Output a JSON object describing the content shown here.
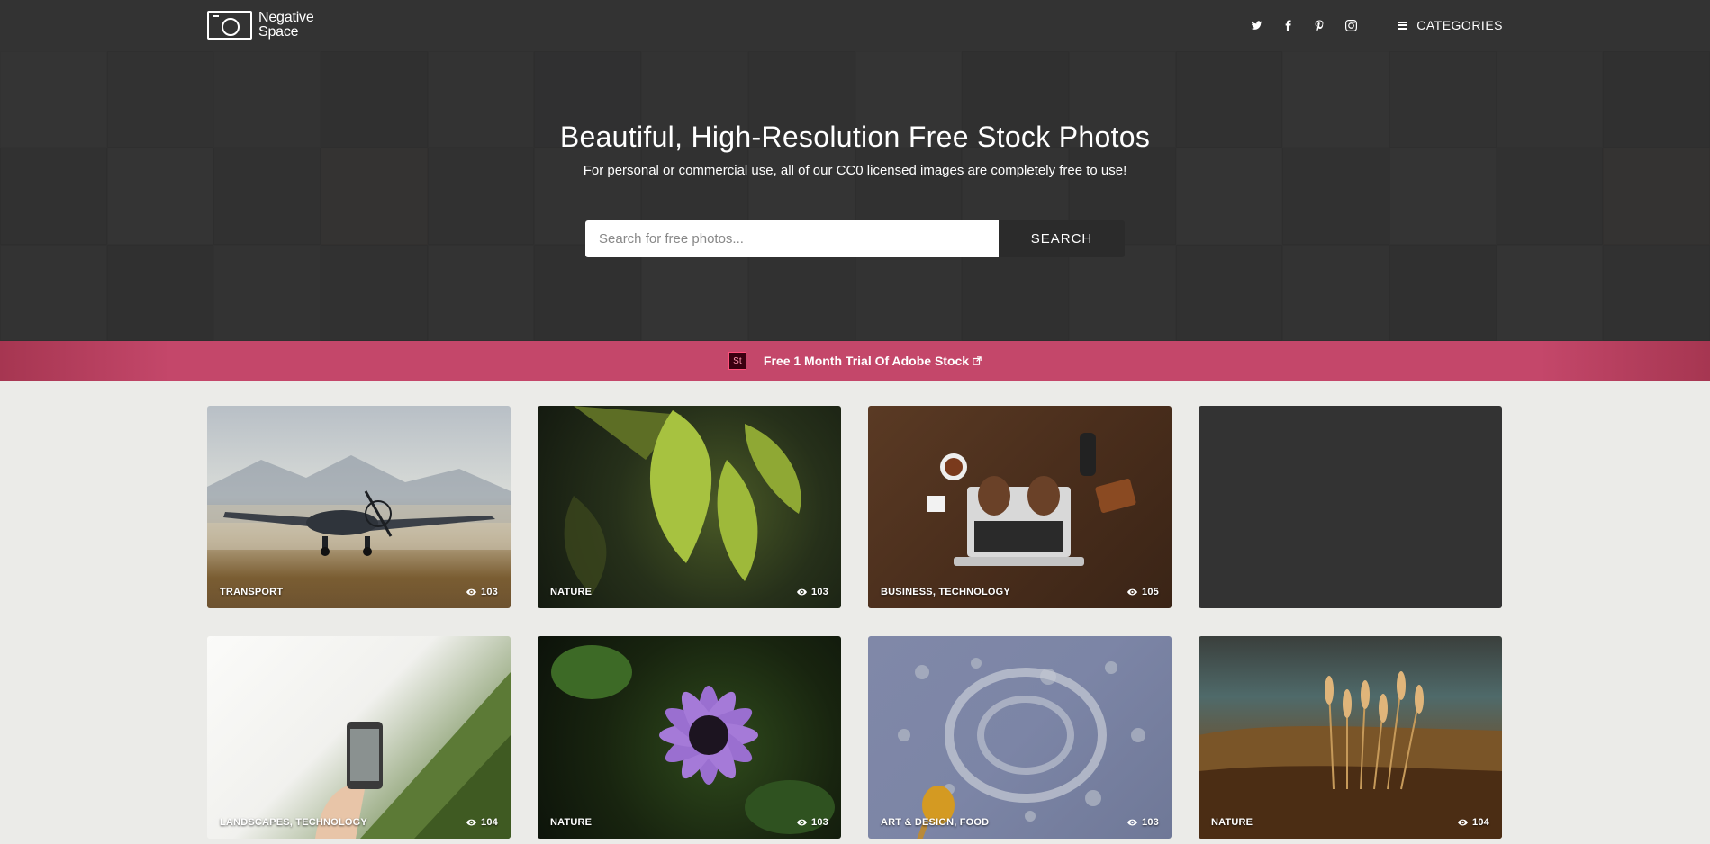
{
  "header": {
    "logo_line1": "Negative",
    "logo_line2": "Space",
    "social_icons": [
      "twitter-icon",
      "facebook-icon",
      "pinterest-icon",
      "instagram-icon"
    ],
    "categories_label": "CATEGORIES"
  },
  "hero": {
    "title": "Beautiful, High-Resolution Free Stock Photos",
    "subtitle": "For personal or commercial use, all of our CC0 licensed images are completely free to use!",
    "search_placeholder": "Search for free photos...",
    "search_value": "",
    "search_button": "SEARCH"
  },
  "promo": {
    "badge": "St",
    "text": "Free 1 Month Trial Of Adobe Stock",
    "color": "#c4476a"
  },
  "photos": [
    {
      "category": "TRANSPORT",
      "views": "103"
    },
    {
      "category": "NATURE",
      "views": "103"
    },
    {
      "category": "BUSINESS, TECHNOLOGY",
      "views": "105"
    },
    {
      "category": "",
      "views": ""
    },
    {
      "category": "LANDSCAPES, TECHNOLOGY",
      "views": "104"
    },
    {
      "category": "NATURE",
      "views": "103"
    },
    {
      "category": "ART & DESIGN, FOOD",
      "views": "103"
    },
    {
      "category": "NATURE",
      "views": "104"
    }
  ]
}
